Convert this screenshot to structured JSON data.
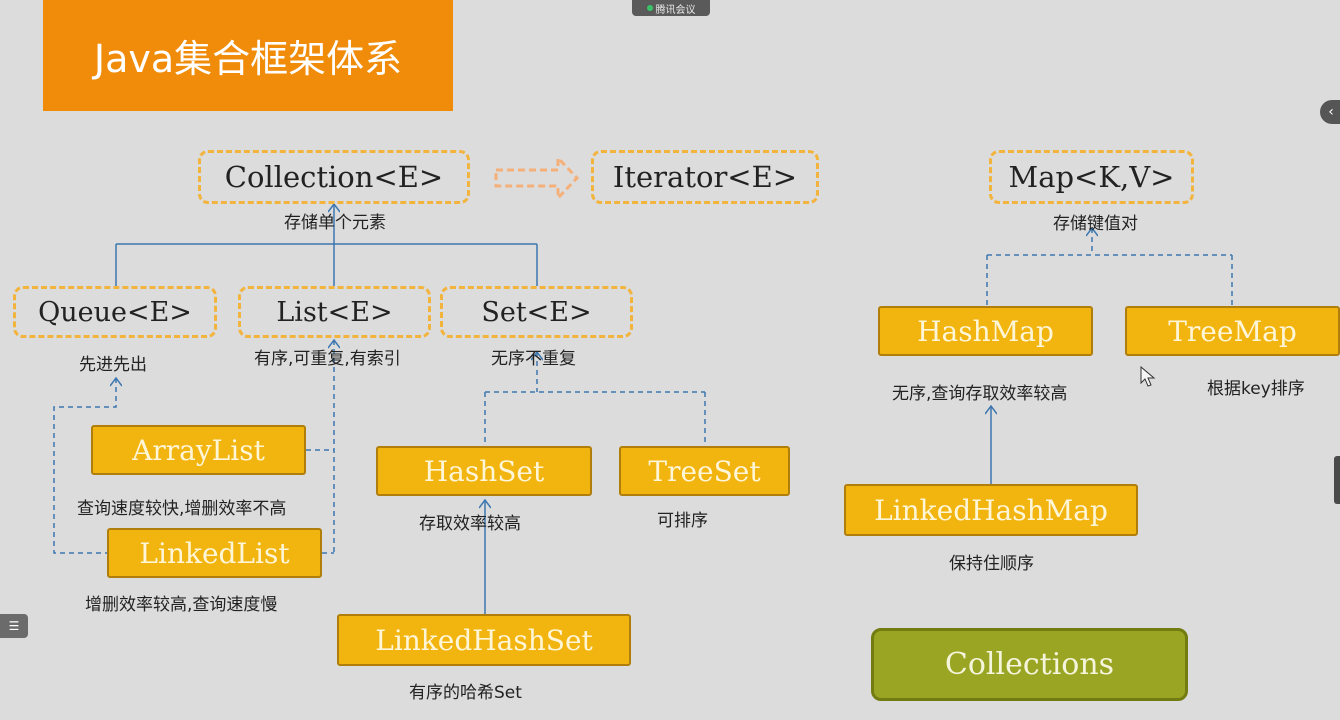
{
  "title": "Java集合框架体系",
  "meeting_badge": "腾讯会议",
  "icons": {
    "realize_arrow": "dashed-hollow-arrow-icon",
    "collapse": "chevron-left-icon",
    "list": "list-icon",
    "cursor": "mouse-pointer-icon"
  },
  "colors": {
    "banner": "#f08c0a",
    "interface_border": "#f2b43c",
    "class_fill": "#f2b40f",
    "utility_fill": "#9aa524",
    "connector": "#3d77b0"
  },
  "interfaces": {
    "collection": "Collection<E>",
    "iterator": "Iterator<E>",
    "map": "Map<K,V>",
    "queue": "Queue<E>",
    "list": "List<E>",
    "set": "Set<E>"
  },
  "classes": {
    "array_list": "ArrayList",
    "linked_list": "LinkedList",
    "hash_set": "HashSet",
    "tree_set": "TreeSet",
    "linked_hash_set": "LinkedHashSet",
    "hash_map": "HashMap",
    "tree_map": "TreeMap",
    "linked_hash_map": "LinkedHashMap",
    "collections": "Collections"
  },
  "captions": {
    "collection": "存储单个元素",
    "map": "存储键值对",
    "queue": "先进先出",
    "list": "有序,可重复,有索引",
    "set": "无序不重复",
    "array_list": "查询速度较快,增删效率不高",
    "linked_list": "增删效率较高,查询速度慢",
    "hash_set": "存取效率较高",
    "tree_set": "可排序",
    "linked_hash_set": "有序的哈希Set",
    "hash_map": "无序,查询存取效率较高",
    "tree_map": "根据key排序",
    "linked_hash_map": "保持住顺序"
  }
}
